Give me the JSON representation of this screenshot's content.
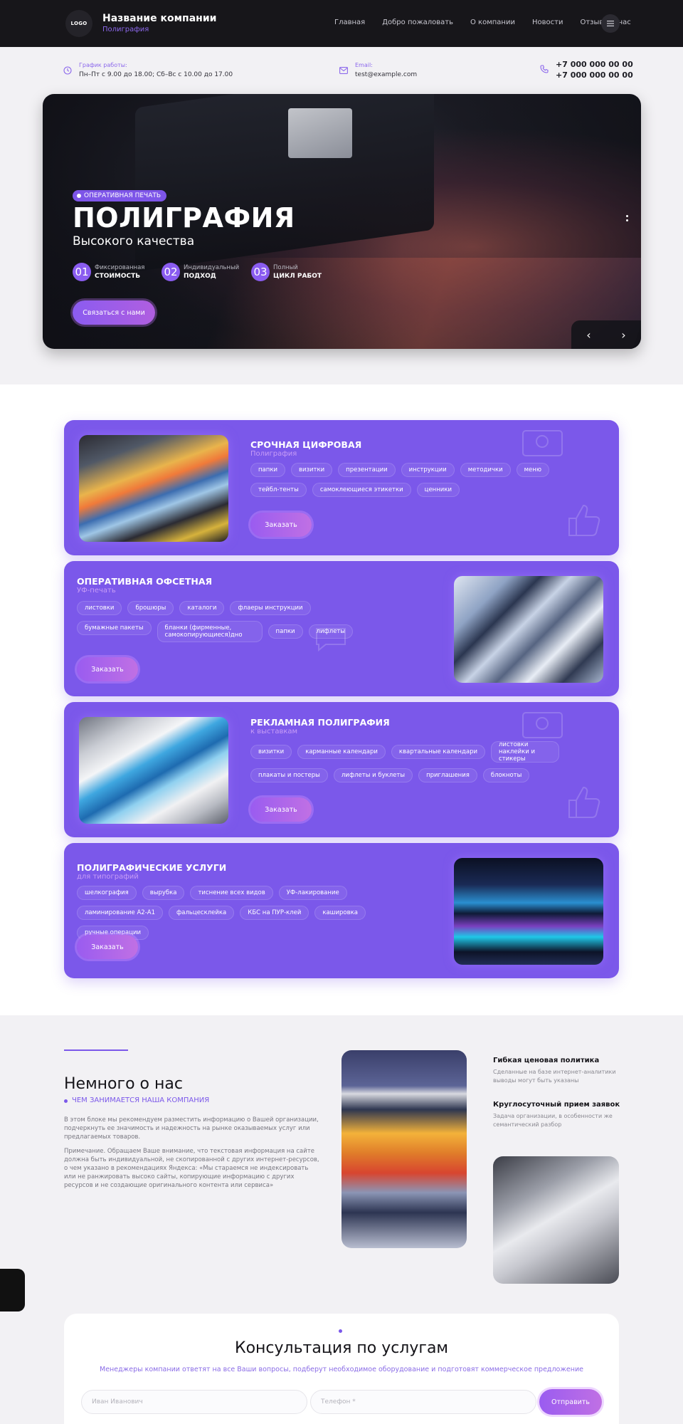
{
  "header": {
    "logo": "LOGO",
    "company_name": "Название компании",
    "company_sub": "Полиграфия",
    "nav": [
      "Главная",
      "Добро пожаловать",
      "О компании",
      "Новости",
      "Отзывы о нас"
    ]
  },
  "topbar": {
    "schedule_label": "График работы:",
    "schedule_value": "Пн–Пт с 9.00 до 18.00; Сб–Вс с 10.00 до 17.00",
    "email_label": "Email:",
    "email_value": "test@example.com",
    "phones": [
      "+7 000 000 00 00",
      "+7 000 000 00 00"
    ]
  },
  "hero": {
    "tag": "ОПЕРАТИВНАЯ ПЕЧАТЬ",
    "title": "ПОЛИГРАФИЯ",
    "subtitle": "Высокого качества",
    "features": [
      {
        "num": "01",
        "line1": "Фиксированная",
        "line2": "СТОИМОСТЬ"
      },
      {
        "num": "02",
        "line1": "Индивидуальный",
        "line2": "ПОДХОД"
      },
      {
        "num": "03",
        "line1": "Полный",
        "line2": "ЦИКЛ РАБОТ"
      }
    ],
    "button": "Связаться с нами",
    "prev_icon": "‹",
    "next_icon": "›"
  },
  "services": [
    {
      "title": "СРОЧНАЯ ЦИФРОВАЯ",
      "subtitle": "Полиграфия",
      "chips": [
        "папки",
        "визитки",
        "презентации",
        "инструкции",
        "методички",
        "меню",
        "тейбл-тенты",
        "самоклеющиеся этикетки",
        "ценники"
      ],
      "button": "Заказать"
    },
    {
      "title": "ОПЕРАТИВНАЯ ОФСЕТНАЯ",
      "subtitle": "УФ-печать",
      "chips": [
        "листовки",
        "брошюры",
        "каталоги",
        "флаеры инструкции",
        "бумажные пакеты",
        "бланки (фирменные, самокопирующиеся)дно",
        "папки",
        "лифлеты"
      ],
      "button": "Заказать"
    },
    {
      "title": "РЕКЛАМНАЯ ПОЛИГРАФИЯ",
      "subtitle": "к выставкам",
      "chips": [
        "визитки",
        "карманные календари",
        "квартальные календари",
        "листовки наклейки и стикеры",
        "плакаты и постеры",
        "лифлеты и буклеты",
        "приглашения",
        "блокноты"
      ],
      "button": "Заказать"
    },
    {
      "title": "ПОЛИГРАФИЧЕСКИЕ УСЛУГИ",
      "subtitle": "для типографий",
      "chips": [
        "шелкография",
        "вырубка",
        "тиснение всех видов",
        "УФ-лакирование",
        "ламинирование А2-А1",
        "фальцесклейка",
        "КБС на ПУР-клей",
        "кашировка",
        "ручные операции"
      ],
      "button": "Заказать"
    }
  ],
  "about": {
    "title": "Немного о нас",
    "subtitle": "ЧЕМ ЗАНИМАЕТСЯ НАША КОМПАНИЯ",
    "p1": "В этом блоке мы рекомендуем разместить информацию о Вашей организации, подчеркнуть ее значимость и надежность на рынке оказываемых услуг или предлагаемых товаров.",
    "p2": "Примечание. Обращаем Ваше внимание, что текстовая информация на сайте должна быть индивидуальной, не скопированной с других интернет-ресурсов, о чем указано в рекомендациях Яндекса: «Мы стараемся не индексировать или не ранжировать высоко сайты, копирующие информацию с других ресурсов и не создающие оригинального контента или сервиса»",
    "items": [
      {
        "title": "Гибкая ценовая политика",
        "text": "Сделанные на базе интернет-аналитики выводы могут быть указаны"
      },
      {
        "title": "Круглосуточный прием заявок",
        "text": "Задача организации, в особенности же семантический разбор"
      }
    ]
  },
  "consult": {
    "title": "Консультация по услугам",
    "subtitle": "Менеджеры компании ответят на все Ваши вопросы, подберут необходимое оборудование и подготовят коммерческое предложение",
    "name_placeholder": "Иван Иванович",
    "phone_placeholder": "Телефон *",
    "button": "Отправить"
  },
  "colors": {
    "accent": "#7b58ea",
    "header_bg": "#17161a",
    "card_bg": "#7b58ea"
  }
}
